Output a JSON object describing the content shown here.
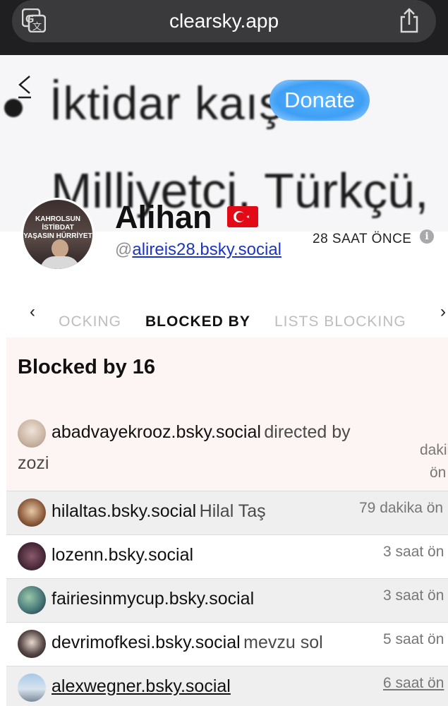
{
  "browser": {
    "url": "clearsky.app"
  },
  "banner": {
    "line1": "İktidar kaışı",
    "line2": "Milliyetci, Türkçü,",
    "donate_label": "Donate"
  },
  "profile": {
    "display_name": "Alihan",
    "handle_prefix": "@",
    "handle": "alireis28.bsky.social",
    "timestamp": "28 SAAT ÖNCE",
    "avatar_text_top": "KAHROLSUN İSTİBDAT",
    "avatar_text_bottom": "YAŞASIN HÜRRİYET"
  },
  "tabs": {
    "prev_label": "‹",
    "next_label": "›",
    "blocking": "BLOCKING",
    "blocked_by": "BLOCKED BY",
    "lists_blocking": "LISTS BLOCKING"
  },
  "panel": {
    "title": "Blocked by 16",
    "rows": [
      {
        "handle": "abadvayekrooz.bsky.social",
        "name": "directed by zozi",
        "time_line1": "dakik",
        "time_line2": "ön"
      },
      {
        "handle": "hilaltas.bsky.social",
        "name": "Hilal Taş",
        "time": "79 dakika ön"
      },
      {
        "handle": "lozenn.bsky.social",
        "name": "",
        "time": "3 saat ön"
      },
      {
        "handle": "fairiesinmycup.bsky.social",
        "name": "",
        "time": "3 saat ön"
      },
      {
        "handle": "devrimofkesi.bsky.social",
        "name": "mevzu sol",
        "time": "5 saat ön"
      },
      {
        "handle": "alexwegner.bsky.social",
        "name": "",
        "time": "6 saat ön"
      }
    ]
  },
  "colors": {
    "accent_link": "#1a35c7",
    "donate": "#3e9ff5",
    "panel_bg": "#fdf5f3",
    "browser_bar": "#1f1f21"
  }
}
